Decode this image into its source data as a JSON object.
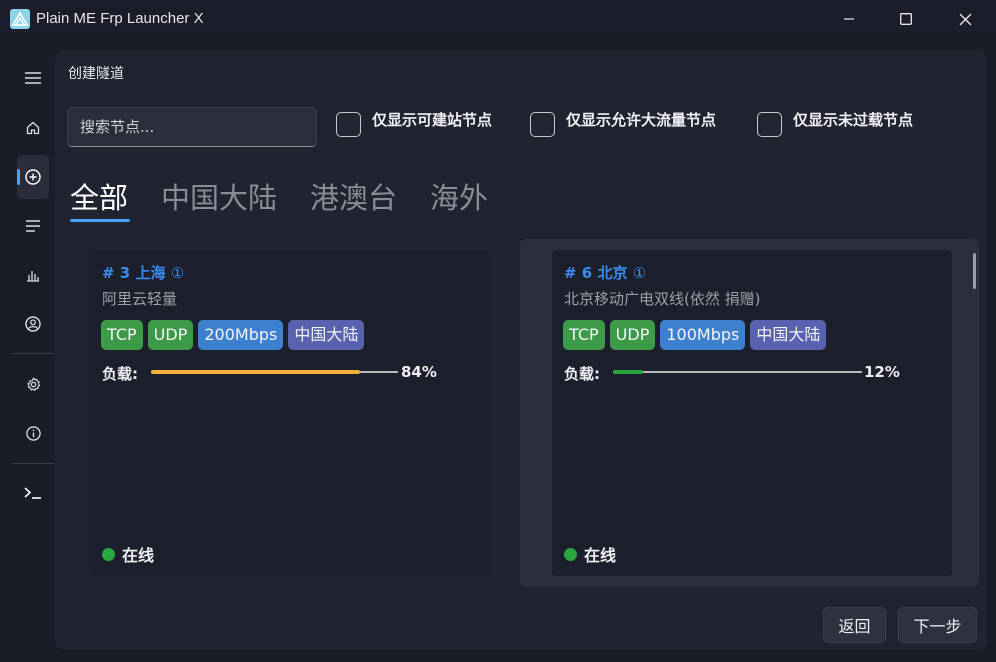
{
  "window": {
    "title": "Plain ME Frp Launcher X",
    "controls": [
      "minimize-icon",
      "maximize-icon",
      "close-icon"
    ]
  },
  "sidebar": {
    "items": [
      {
        "icon": "hamburger-menu-icon"
      },
      {
        "icon": "home-icon"
      },
      {
        "icon": "add-circle-icon",
        "active": true
      },
      {
        "icon": "list-icon"
      },
      {
        "icon": "bar-chart-icon"
      },
      {
        "icon": "user-icon"
      },
      {
        "icon": "settings-icon"
      },
      {
        "icon": "info-icon"
      },
      {
        "icon": "terminal-icon"
      }
    ]
  },
  "page": {
    "title": "创建隧道",
    "search_placeholder": "搜索节点...",
    "filters": [
      {
        "label": "仅显示可建站节点",
        "checked": false
      },
      {
        "label": "仅显示允许大流量节点",
        "checked": false
      },
      {
        "label": "仅显示未过载节点",
        "checked": false
      }
    ],
    "tabs": [
      {
        "label": "全部",
        "active": true
      },
      {
        "label": "中国大陆",
        "active": false
      },
      {
        "label": "港澳台",
        "active": false
      },
      {
        "label": "海外",
        "active": false
      }
    ]
  },
  "nodes": [
    {
      "id_label": "# 3",
      "city": "上海",
      "info_icon": "①",
      "description": "阿里云轻量",
      "tags": [
        {
          "text": "TCP",
          "color": "#3d9a48"
        },
        {
          "text": "UDP",
          "color": "#3d9a48"
        },
        {
          "text": "200Mbps",
          "color": "#3d80d0"
        },
        {
          "text": "中国大陆",
          "color": "#5a62b0"
        }
      ],
      "load_label": "负载:",
      "load_percent": 84,
      "load_text": "84%",
      "load_color": "#f2b13d",
      "status_text": "在线",
      "status_color": "#2aa640",
      "selected": false
    },
    {
      "id_label": "# 6",
      "city": "北京",
      "info_icon": "①",
      "description": "北京移动广电双线(依然 捐赠)",
      "tags": [
        {
          "text": "TCP",
          "color": "#3d9a48"
        },
        {
          "text": "UDP",
          "color": "#3d9a48"
        },
        {
          "text": "100Mbps",
          "color": "#3d80d0"
        },
        {
          "text": "中国大陆",
          "color": "#5a62b0"
        }
      ],
      "load_label": "负载:",
      "load_percent": 12,
      "load_text": "12%",
      "load_color": "#2aa640",
      "status_text": "在线",
      "status_color": "#2aa640",
      "selected": true
    }
  ],
  "footer": {
    "back_label": "返回",
    "next_label": "下一步"
  }
}
